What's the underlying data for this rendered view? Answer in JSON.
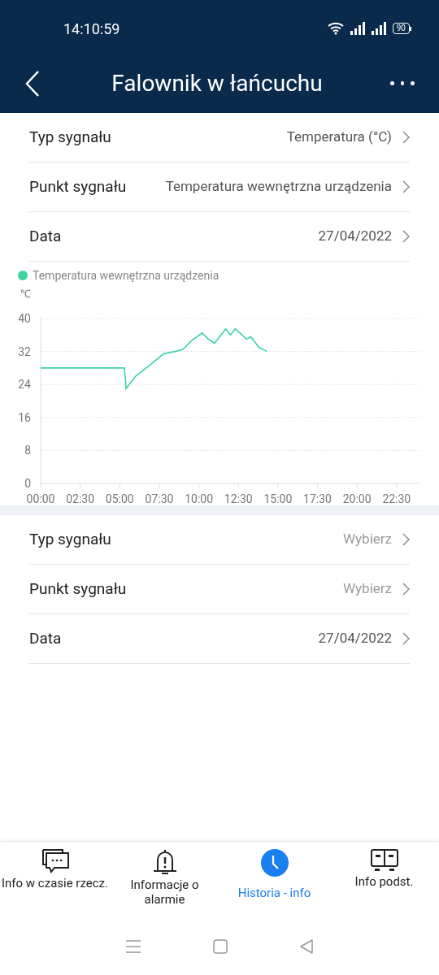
{
  "status_bar": {
    "time": "14:10:59",
    "battery": "90"
  },
  "header": {
    "title": "Falownik w łańcuchu"
  },
  "groups": [
    {
      "rows": [
        {
          "label": "Typ sygnału",
          "value": "Temperatura (°C)"
        },
        {
          "label": "Punkt sygnału",
          "value": "Temperatura wewnętrzna urządzenia"
        },
        {
          "label": "Data",
          "value": "27/04/2022"
        }
      ],
      "chart": {
        "unit": "℃",
        "chart_data": {
          "type": "line",
          "grid": true,
          "x": [
            0,
            5.3,
            5.4,
            6,
            7,
            7.8,
            8.5,
            9,
            9.5,
            10.2,
            10.6,
            11,
            11.3,
            11.7,
            12,
            12.3,
            12.6,
            13,
            13.3,
            13.8,
            14.3
          ],
          "series": [
            {
              "name": "Temperatura wewnętrzna urządzenia",
              "color": "#3dd3a0",
              "values": [
                28,
                28,
                23,
                26,
                29,
                31.5,
                32,
                32.5,
                34.5,
                36.5,
                35,
                34,
                35.5,
                37.5,
                36,
                37.5,
                36.5,
                35,
                35.5,
                33,
                32
              ]
            }
          ],
          "xlim": [
            0,
            24
          ],
          "ylim": [
            0,
            40
          ],
          "yticks": [
            0,
            8,
            16,
            24,
            32,
            40
          ],
          "xticks": [
            {
              "value": 0,
              "label": "00:00"
            },
            {
              "value": 2.5,
              "label": "02:30"
            },
            {
              "value": 5,
              "label": "05:00"
            },
            {
              "value": 7.5,
              "label": "07:30"
            },
            {
              "value": 10,
              "label": "10:00"
            },
            {
              "value": 12.5,
              "label": "12:30"
            },
            {
              "value": 15,
              "label": "15:00"
            },
            {
              "value": 17.5,
              "label": "17:30"
            },
            {
              "value": 20,
              "label": "20:00"
            },
            {
              "value": 22.5,
              "label": "22:30"
            }
          ]
        }
      }
    },
    {
      "rows": [
        {
          "label": "Typ sygnału",
          "placeholder": "Wybierz"
        },
        {
          "label": "Punkt sygnału",
          "placeholder": "Wybierz"
        },
        {
          "label": "Data",
          "value": "27/04/2022"
        }
      ]
    }
  ],
  "bottom_nav": [
    {
      "label": "Info w czasie rzecz.",
      "selected": false
    },
    {
      "label": "Informacje o alarmie",
      "selected": false
    },
    {
      "label": "Historia - info",
      "selected": true
    },
    {
      "label": "Info podst.",
      "selected": false
    }
  ]
}
